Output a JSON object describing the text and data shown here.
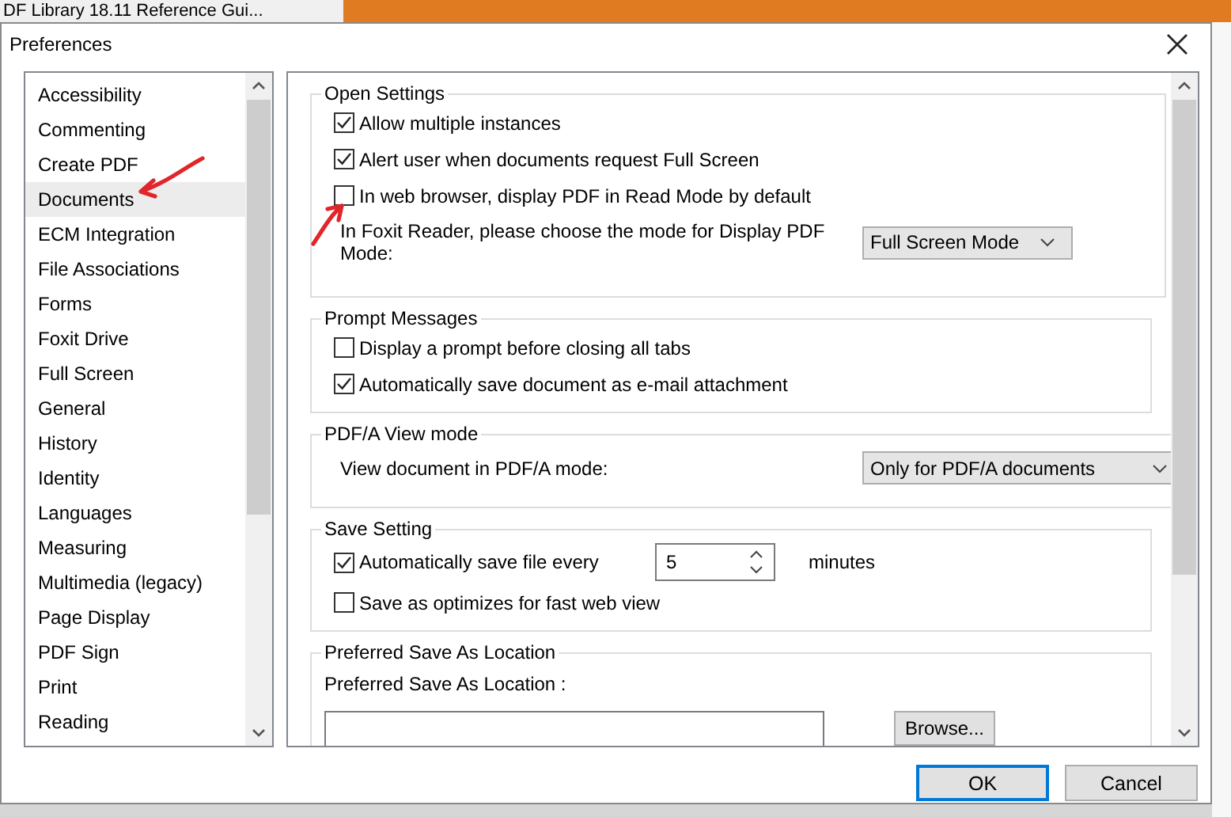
{
  "background_window": {
    "title": "DF Library 18.11 Reference Gui..."
  },
  "window": {
    "title": "Preferences"
  },
  "categories": [
    {
      "label": "Accessibility",
      "selected": false
    },
    {
      "label": "Commenting",
      "selected": false
    },
    {
      "label": "Create PDF",
      "selected": false
    },
    {
      "label": "Documents",
      "selected": true
    },
    {
      "label": "ECM Integration",
      "selected": false
    },
    {
      "label": "File Associations",
      "selected": false
    },
    {
      "label": "Forms",
      "selected": false
    },
    {
      "label": "Foxit Drive",
      "selected": false
    },
    {
      "label": "Full Screen",
      "selected": false
    },
    {
      "label": "General",
      "selected": false
    },
    {
      "label": "History",
      "selected": false
    },
    {
      "label": "Identity",
      "selected": false
    },
    {
      "label": "Languages",
      "selected": false
    },
    {
      "label": "Measuring",
      "selected": false
    },
    {
      "label": "Multimedia (legacy)",
      "selected": false
    },
    {
      "label": "Page Display",
      "selected": false
    },
    {
      "label": "PDF Sign",
      "selected": false
    },
    {
      "label": "Print",
      "selected": false
    },
    {
      "label": "Reading",
      "selected": false
    }
  ],
  "sections": [
    {
      "title": "Open Settings",
      "items": [
        {
          "kind": "checkbox",
          "label": "Allow multiple instances",
          "checked": true
        },
        {
          "kind": "checkbox",
          "label": "Alert user when documents request Full Screen",
          "checked": true
        },
        {
          "kind": "checkbox",
          "label": "In web browser, display PDF in Read Mode by default",
          "checked": false
        },
        {
          "kind": "select",
          "label": "In Foxit Reader, please choose the mode for Display PDF Mode:",
          "value": "Full Screen Mode"
        }
      ]
    },
    {
      "title": "Prompt Messages",
      "items": [
        {
          "kind": "checkbox",
          "label": "Display a prompt before closing all tabs",
          "checked": false
        },
        {
          "kind": "checkbox",
          "label": "Automatically save document as e-mail attachment",
          "checked": true
        }
      ]
    },
    {
      "title": "PDF/A View mode",
      "items": [
        {
          "kind": "select",
          "label": "View document in PDF/A mode:",
          "value": "Only for PDF/A documents"
        }
      ]
    },
    {
      "title": "Save Setting",
      "items": [
        {
          "kind": "spinner",
          "label": "Automatically save file every",
          "checked": true,
          "value": "5",
          "unit": "minutes"
        },
        {
          "kind": "checkbox",
          "label": "Save as optimizes for fast web view",
          "checked": false
        }
      ]
    },
    {
      "title": "Preferred Save As Location",
      "items": [
        {
          "kind": "path",
          "label": "Preferred Save As Location :",
          "button": "Browse..."
        }
      ]
    }
  ],
  "buttons": [
    {
      "label": "OK",
      "default": true
    },
    {
      "label": "Cancel",
      "default": false
    }
  ]
}
